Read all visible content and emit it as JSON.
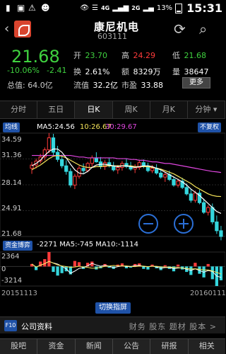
{
  "status_bar": {
    "network1": "4G",
    "network2": "2G",
    "battery": "13%",
    "time": "15:31"
  },
  "header": {
    "stock_name": "康尼机电",
    "stock_code": "603111"
  },
  "quote": {
    "price": "21.68",
    "change_pct": "-10.06%",
    "change_abs": "-2.41",
    "market_cap_label": "总值",
    "market_cap": "64.0亿",
    "open_label": "开",
    "open": "23.70",
    "high_label": "高",
    "high": "24.29",
    "low_label": "低",
    "low": "21.68",
    "turnover_label": "换",
    "turnover": "2.61%",
    "amount_label": "额",
    "amount": "8329万",
    "volume_label": "量",
    "volume": "38647",
    "float_label": "流值",
    "float_value": "32.2亿",
    "pe_label": "市盈",
    "pe": "33.88",
    "more_button": "更多"
  },
  "tabs": [
    {
      "label": "分时",
      "active": false
    },
    {
      "label": "五日",
      "active": false
    },
    {
      "label": "日K",
      "active": true
    },
    {
      "label": "周K",
      "active": false
    },
    {
      "label": "月K",
      "active": false
    },
    {
      "label": "分钟",
      "active": false
    }
  ],
  "chart": {
    "ma_tag": "均线",
    "ma5_label": "MA5:24.56",
    "ma10_label": "10:26.67",
    "ma30_label": "30:29.67",
    "adjust_tag": "不复权",
    "y_ticks": [
      "34.59",
      "31.36",
      "28.14",
      "24.91",
      "21.68"
    ],
    "vol_tag": "资金博弈",
    "vol_label": "-2271 MA5:-745 MA10:-1114",
    "vol_ticks": [
      "2364",
      "0",
      "-3214"
    ],
    "date_left": "20151113",
    "date_right": "20160111",
    "switch_button": "切换指屏"
  },
  "chart_data": {
    "type": "candlestick",
    "title": "",
    "y_range": [
      21.68,
      34.59
    ],
    "candles": [
      [
        30.2,
        31.0,
        29.5,
        30.6
      ],
      [
        30.6,
        31.4,
        30.2,
        31.1
      ],
      [
        31.1,
        32.0,
        30.8,
        31.6
      ],
      [
        31.6,
        32.8,
        31.2,
        32.5
      ],
      [
        32.5,
        34.6,
        32.1,
        34.0
      ],
      [
        34.0,
        34.5,
        31.8,
        32.2
      ],
      [
        32.2,
        33.0,
        31.0,
        31.3
      ],
      [
        31.3,
        31.9,
        30.2,
        30.5
      ],
      [
        30.5,
        31.2,
        29.4,
        29.8
      ],
      [
        29.8,
        30.2,
        27.8,
        28.1
      ],
      [
        28.1,
        29.5,
        27.6,
        29.2
      ],
      [
        29.2,
        30.5,
        28.9,
        30.2
      ],
      [
        30.2,
        30.8,
        29.6,
        29.9
      ],
      [
        29.9,
        31.0,
        29.7,
        30.8
      ],
      [
        30.8,
        31.8,
        30.4,
        31.5
      ],
      [
        31.5,
        32.2,
        30.9,
        31.0
      ],
      [
        31.0,
        31.6,
        30.1,
        30.4
      ],
      [
        30.4,
        31.2,
        30.0,
        30.9
      ],
      [
        30.9,
        31.5,
        30.3,
        30.5
      ],
      [
        30.5,
        31.0,
        29.8,
        30.0
      ],
      [
        30.0,
        30.6,
        29.5,
        30.3
      ],
      [
        30.3,
        31.1,
        29.9,
        30.8
      ],
      [
        30.8,
        31.4,
        30.2,
        30.4
      ],
      [
        30.4,
        31.0,
        29.9,
        30.1
      ],
      [
        30.1,
        30.7,
        29.6,
        30.3
      ],
      [
        30.3,
        31.2,
        30.0,
        30.9
      ],
      [
        30.9,
        31.3,
        30.2,
        30.5
      ],
      [
        30.5,
        30.9,
        29.7,
        29.9
      ],
      [
        29.9,
        30.6,
        29.6,
        30.2
      ],
      [
        30.2,
        30.7,
        29.4,
        29.6
      ],
      [
        29.6,
        30.1,
        28.9,
        29.1
      ],
      [
        29.1,
        29.7,
        28.5,
        29.4
      ],
      [
        29.4,
        29.9,
        28.6,
        28.8
      ],
      [
        28.8,
        29.2,
        27.9,
        28.1
      ],
      [
        28.1,
        28.9,
        27.8,
        28.6
      ],
      [
        28.6,
        29.0,
        27.6,
        27.8
      ],
      [
        27.8,
        28.3,
        26.8,
        27.0
      ],
      [
        27.0,
        27.6,
        25.9,
        26.2
      ],
      [
        26.2,
        27.4,
        25.9,
        27.1
      ],
      [
        27.1,
        27.5,
        25.7,
        25.9
      ],
      [
        25.9,
        26.4,
        24.5,
        24.7
      ],
      [
        24.7,
        25.6,
        24.3,
        25.3
      ],
      [
        25.3,
        25.8,
        23.2,
        23.5
      ],
      [
        23.5,
        24.3,
        22.0,
        22.4
      ],
      [
        22.4,
        23.0,
        21.2,
        21.68
      ]
    ],
    "ma5": [
      30.5,
      30.8,
      31.2,
      31.8,
      32.3,
      32.6,
      32.6,
      32.2,
      31.5,
      30.7,
      30.0,
      29.6,
      29.5,
      29.8,
      30.3,
      30.6,
      30.7,
      30.7,
      30.6,
      30.5,
      30.4,
      30.5,
      30.5,
      30.4,
      30.3,
      30.4,
      30.5,
      30.5,
      30.4,
      30.2,
      30.0,
      29.7,
      29.4,
      29.1,
      28.8,
      28.5,
      28.1,
      27.6,
      27.2,
      26.8,
      26.3,
      25.8,
      25.3,
      24.8,
      24.56
    ],
    "ma10": [
      30.0,
      30.3,
      30.6,
      31.0,
      31.4,
      31.7,
      31.8,
      31.7,
      31.5,
      31.2,
      30.9,
      30.6,
      30.4,
      30.3,
      30.3,
      30.4,
      30.4,
      30.5,
      30.5,
      30.5,
      30.5,
      30.5,
      30.5,
      30.5,
      30.4,
      30.4,
      30.4,
      30.4,
      30.3,
      30.2,
      30.1,
      29.9,
      29.7,
      29.5,
      29.2,
      28.9,
      28.6,
      28.3,
      27.9,
      27.6,
      27.3,
      27.0,
      26.8,
      26.7,
      26.67
    ],
    "ma30": [
      31.8,
      31.8,
      31.8,
      31.8,
      31.8,
      31.8,
      31.8,
      31.8,
      31.8,
      31.8,
      31.7,
      31.6,
      31.6,
      31.5,
      31.5,
      31.5,
      31.5,
      31.5,
      31.5,
      31.5,
      31.4,
      31.4,
      31.4,
      31.3,
      31.3,
      31.2,
      31.2,
      31.1,
      31.0,
      31.0,
      30.9,
      30.8,
      30.8,
      30.7,
      30.6,
      30.5,
      30.4,
      30.3,
      30.2,
      30.1,
      30.0,
      29.9,
      29.8,
      29.75,
      29.67
    ],
    "capital_flow": [
      400,
      -600,
      800,
      1200,
      2364,
      -900,
      -1500,
      -1100,
      -800,
      -1300,
      900,
      700,
      -400,
      600,
      800,
      -500,
      -300,
      400,
      -200,
      -400,
      300,
      500,
      -300,
      -200,
      400,
      500,
      -400,
      -500,
      300,
      -300,
      -600,
      200,
      -400,
      -800,
      300,
      -500,
      -900,
      -1400,
      600,
      -1200,
      -1800,
      400,
      -2100,
      -3214,
      -2271
    ],
    "vol_range": [
      -3214,
      2364
    ]
  },
  "f10": {
    "tag": "F10",
    "title": "公司资料",
    "links": "财务 股东 题材 股本 >"
  },
  "bottom_nav": [
    "股吧",
    "资金",
    "新闻",
    "公告",
    "研报",
    "相关"
  ]
}
